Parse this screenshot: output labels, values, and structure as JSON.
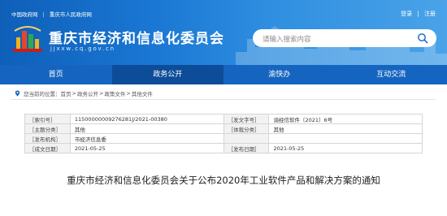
{
  "top_links": {
    "gov": "中国政府网",
    "city": "重庆市人民政府网",
    "sep": "|"
  },
  "user_links": {
    "login": "登录",
    "register": "注册",
    "sep": "|"
  },
  "site": {
    "title": "重庆市经济和信息化委员会",
    "domain": "jjxxw.cq.gov.cn"
  },
  "search": {
    "placeholder": "请输入搜索内容"
  },
  "nav": {
    "items": [
      "首页",
      "政务公开",
      "渝快办",
      "互动交流"
    ],
    "active": "政务公开"
  },
  "breadcrumb": {
    "prefix": "您当前的位置：",
    "items": [
      "首页",
      "政务公开",
      "政策文件",
      "其他文件"
    ],
    "sep": ">"
  },
  "meta": {
    "rows": [
      [
        {
          "label": "［索引号］",
          "value": "11500000009276281J/2021-00380"
        },
        {
          "label": "［发文字号］",
          "value": "渝经信软件〔2021〕6号"
        }
      ],
      [
        {
          "label": "［主题分类］",
          "value": "其他"
        },
        {
          "label": "［体裁分类］",
          "value": "其他"
        }
      ],
      [
        {
          "label": "［发布机构］",
          "value": "市经济信息委"
        },
        {
          "label": "",
          "value": ""
        }
      ],
      [
        {
          "label": "［成文日期］",
          "value": "2021-05-25"
        },
        {
          "label": "［发布日期］",
          "value": "2021-05-25"
        }
      ]
    ]
  },
  "document": {
    "title": "重庆市经济和信息化委员会关于公布2020年工业软件产品和解决方案的通知"
  },
  "colors": {
    "header": "#1a78d4",
    "nav": "#1565c0",
    "nav_active": "#0d4c99"
  },
  "icons": {
    "search": "search-icon",
    "location": "location-pin-icon",
    "logo": "site-logo-icon"
  }
}
